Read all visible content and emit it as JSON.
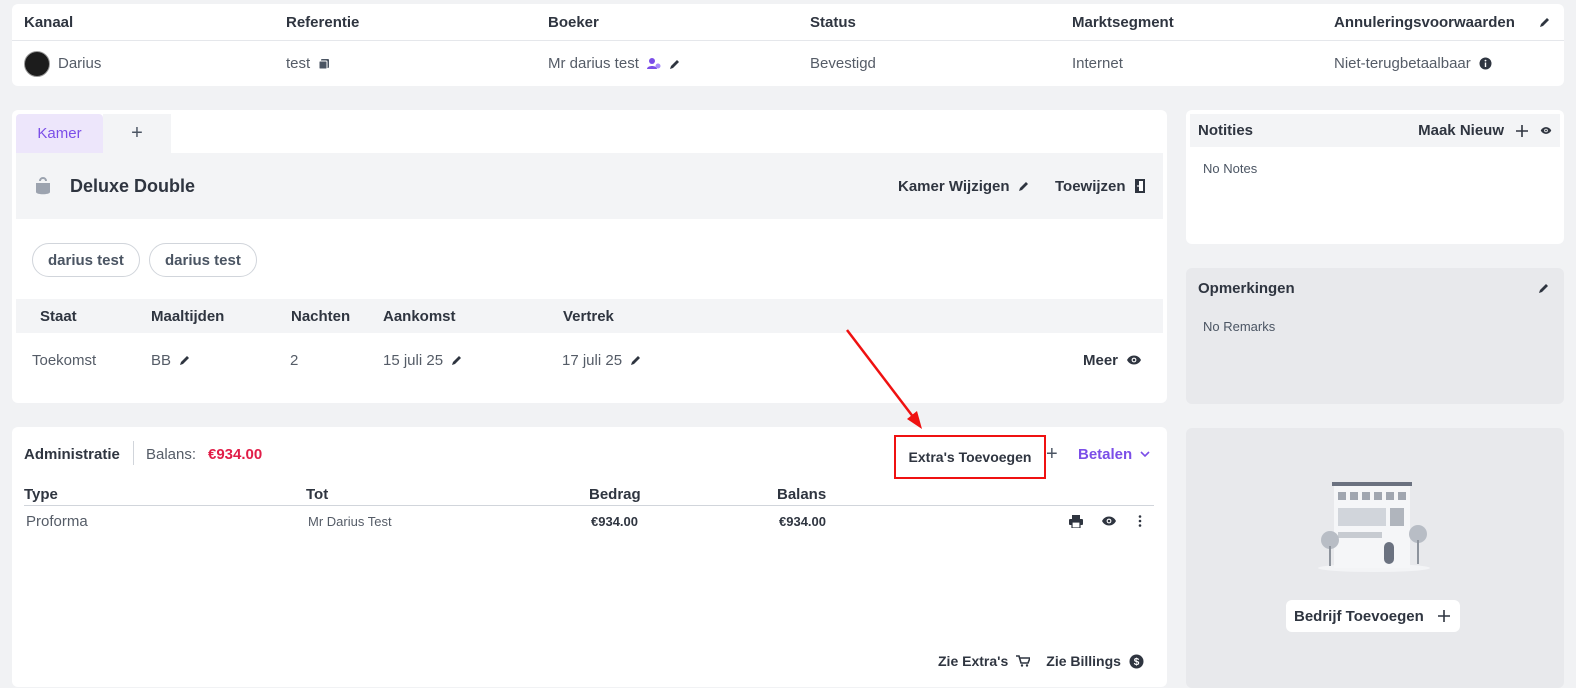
{
  "booking": {
    "headers": {
      "channel": "Kanaal",
      "reference": "Referentie",
      "booker": "Boeker",
      "status": "Status",
      "segment": "Marktsegment",
      "cancellation": "Annuleringsvoorwaarden"
    },
    "channel": "Darius",
    "reference": "test",
    "booker": "Mr darius test",
    "status": "Bevestigd",
    "segment": "Internet",
    "cancellation": "Niet-terugbetaalbaar"
  },
  "room": {
    "tabs": [
      {
        "label": "Kamer"
      },
      {
        "label": "+"
      }
    ],
    "name": "Deluxe Double",
    "change_label": "Kamer Wijzigen",
    "assign_label": "Toewijzen",
    "guests": [
      "darius test",
      "darius test"
    ],
    "stay_headers": [
      "Staat",
      "Maaltijden",
      "Nachten",
      "Aankomst",
      "Vertrek"
    ],
    "stay": {
      "state": "Toekomst",
      "meals": "BB",
      "nights": "2",
      "arrival": "15 juli 25",
      "departure": "17 juli 25",
      "more_label": "Meer"
    }
  },
  "admin": {
    "title": "Administratie",
    "balance_label": "Balans:",
    "balance_value": "€934.00",
    "extras_label": "Extra's Toevoegen",
    "add_symbol": "+",
    "pay_label": "Betalen",
    "headers": [
      "Type",
      "Tot",
      "Bedrag",
      "Balans"
    ],
    "rows": [
      {
        "type": "Proforma",
        "to": "Mr Darius Test",
        "amount": "€934.00",
        "balance": "€934.00"
      }
    ],
    "links": {
      "extras": "Zie Extra's",
      "billings": "Zie Billings"
    }
  },
  "notes": {
    "title": "Notities",
    "new_label": "Maak Nieuw",
    "empty": "No Notes"
  },
  "remarks": {
    "title": "Opmerkingen",
    "empty": "No Remarks"
  },
  "company": {
    "add_label": "Bedrijf Toevoegen"
  },
  "colors": {
    "accent": "#7b4ee8",
    "balance": "#e11d48",
    "annotation": "#ef1111"
  }
}
